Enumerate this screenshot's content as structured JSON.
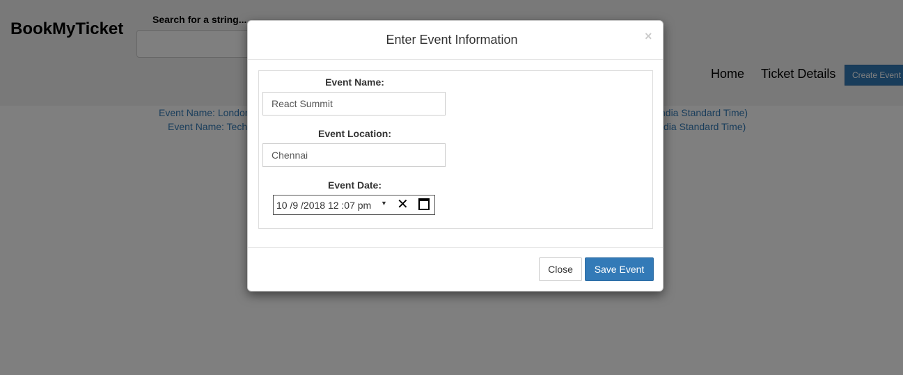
{
  "navbar": {
    "brand": "BookMyTicket",
    "search_label": "Search for a string...",
    "search_value": "",
    "links": [
      "Home",
      "Ticket Details"
    ],
    "create_button": "Create Event"
  },
  "events": [
    {
      "left_text": "Event Name: London",
      "right_text": "ndia Standard Time)"
    },
    {
      "left_text": "Event Name: Tech",
      "right_text": "dia Standard Time)"
    }
  ],
  "modal": {
    "title": "Enter Event Information",
    "close_x": "×",
    "fields": {
      "name_label": "Event Name:",
      "name_value": "React Summit",
      "location_label": "Event Location:",
      "location_value": "Chennai",
      "date_label": "Event Date:",
      "date_value": "10 /9 /2018  12 :07  pm",
      "date_caret": "▼",
      "date_clear": "✕"
    },
    "buttons": {
      "close": "Close",
      "save": "Save Event"
    }
  },
  "colors": {
    "primary": "#337ab7",
    "link": "#337ab7",
    "backdrop": "rgba(0,0,0,0.5)"
  }
}
